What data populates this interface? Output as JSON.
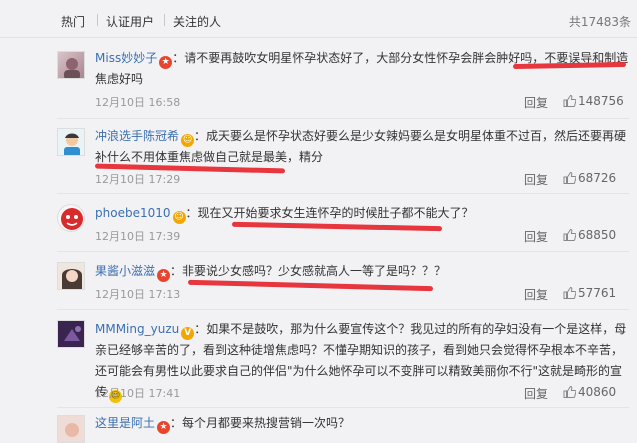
{
  "tabs": [
    "热门",
    "认证用户",
    "关注的人"
  ],
  "total_count": "共17483条",
  "reply_label": "回复",
  "comments": [
    {
      "username": "Miss妙妙子",
      "text": "：请不要再鼓吹女明星怀孕状态好了，大部分女性怀孕会胖会肿好吗，不要误导和制造焦虑好吗",
      "time": "12月10日 16:58",
      "likes": "148756",
      "badge_color": "#e8442e"
    },
    {
      "username": "冲浪选手陈冠希",
      "text": "：成天要么是怀孕状态好要么是少女辣妈要么是女明星体重不过百，然后还要再硬补什么不用体重焦虑做自己就是最美，精分",
      "time": "12月10日 17:29",
      "likes": "68726",
      "badge_color": "#f2a600"
    },
    {
      "username": "phoebe1010",
      "text": "：现在又开始要求女生连怀孕的时候肚子都不能大了？",
      "time": "12月10日 17:39",
      "likes": "68850",
      "badge_color": "#f2a600"
    },
    {
      "username": "果酱小滋滋",
      "text": "：非要说少女感吗？少女感就高人一等了是吗？？？",
      "time": "12月10日 17:13",
      "likes": "57761",
      "badge_color": "#e8442e"
    },
    {
      "username": "MMMing_yuzu",
      "text": "：如果不是鼓吹，那为什么要宣传这个？我见过的所有的孕妇没有一个是这样，母亲已经够辛苦的了，看到这种徒增焦虑吗？不懂孕期知识的孩子，看到她只会觉得怀孕根本不辛苦，还可能会有男性以此要求自己的伴侣\"为什么她怀孕可以不变胖可以精致美丽你不行\"这就是畸形的宣传",
      "time": "12月10日 17:41",
      "likes": "40860",
      "badge_color": "#f2a600"
    },
    {
      "username": "这里是阿土",
      "text": "：每个月都要来热搜营销一次吗？",
      "time": "",
      "likes": "",
      "badge_color": "#e8442e"
    }
  ]
}
